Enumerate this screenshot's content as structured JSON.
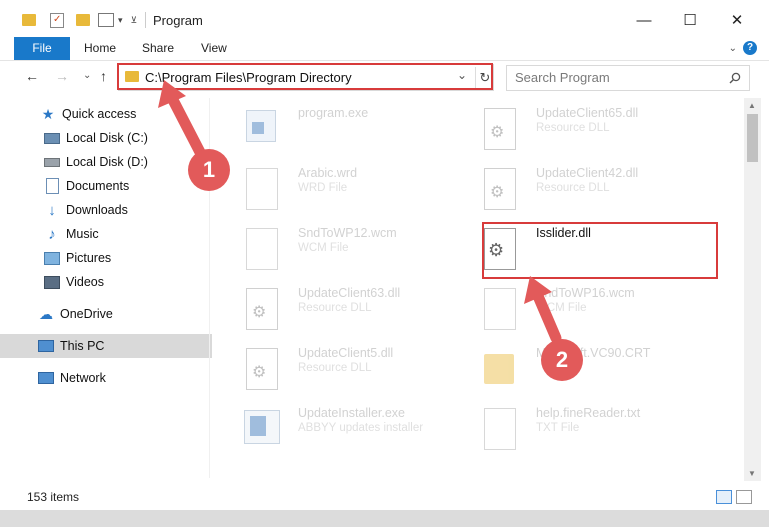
{
  "window": {
    "title": "Program"
  },
  "window_controls": {
    "minimize": "—",
    "maximize": "☐",
    "close": "✕"
  },
  "ribbon": {
    "tabs": [
      "File",
      "Home",
      "Share",
      "View"
    ],
    "help": "?"
  },
  "nav": {
    "back": "←",
    "forward": "→",
    "up_history": "⌄",
    "up": "↑",
    "refresh": "↻",
    "dropdown": "⌄"
  },
  "address": {
    "path": "C:\\Program Files\\Program Directory"
  },
  "search": {
    "placeholder": "Search Program"
  },
  "sidebar": {
    "items": [
      {
        "label": "Quick access",
        "icon": "star-icon",
        "pinned": false
      },
      {
        "label": "Local Disk (C:)",
        "icon": "drive-icon",
        "pinned": true
      },
      {
        "label": "Local Disk (D:)",
        "icon": "drive-icon",
        "pinned": true
      },
      {
        "label": "Documents",
        "icon": "documents-icon",
        "pinned": true
      },
      {
        "label": "Downloads",
        "icon": "download-icon",
        "pinned": true
      },
      {
        "label": "Music",
        "icon": "music-icon",
        "pinned": true
      },
      {
        "label": "Pictures",
        "icon": "pictures-icon",
        "pinned": true
      },
      {
        "label": "Videos",
        "icon": "videos-icon",
        "pinned": true
      },
      {
        "label": "OneDrive",
        "icon": "cloud-icon",
        "pinned": false
      },
      {
        "label": "This PC",
        "icon": "computer-icon",
        "pinned": false,
        "selected": true
      },
      {
        "label": "Network",
        "icon": "network-icon",
        "pinned": false
      }
    ]
  },
  "files": {
    "items": [
      {
        "name": "program.exe",
        "type": "",
        "icon": "exe-icon"
      },
      {
        "name": "UpdateClient65.dll",
        "type": "Resource DLL",
        "icon": "dll-icon"
      },
      {
        "name": "Arabic.wrd",
        "type": "WRD File",
        "icon": "generic-file-icon"
      },
      {
        "name": "UpdateClient42.dll",
        "type": "Resource DLL",
        "icon": "dll-icon"
      },
      {
        "name": "SndToWP12.wcm",
        "type": "WCM File",
        "icon": "generic-file-icon"
      },
      {
        "name": "Isslider.dll",
        "type": "",
        "icon": "dll-icon",
        "highlighted": true
      },
      {
        "name": "UpdateClient63.dll",
        "type": "Resource DLL",
        "icon": "dll-icon"
      },
      {
        "name": "SndToWP16.wcm",
        "type": "WCM File",
        "icon": "generic-file-icon"
      },
      {
        "name": "UpdateClient5.dll",
        "type": "Resource DLL",
        "icon": "dll-icon"
      },
      {
        "name": "Microsoft.VC90.CRT",
        "type": "",
        "icon": "folder-icon"
      },
      {
        "name": "UpdateInstaller.exe",
        "type": "ABBYY updates installer",
        "icon": "installer-icon"
      },
      {
        "name": "help.fineReader.txt",
        "type": "TXT File",
        "icon": "generic-file-icon"
      }
    ]
  },
  "status": {
    "count": "153 items"
  },
  "annotations": {
    "marker_1": "1",
    "marker_2": "2"
  },
  "colors": {
    "accent": "#1979ca",
    "highlight": "#d83b3b",
    "marker": "#e25a5a",
    "selected": "#d9d9d9"
  }
}
